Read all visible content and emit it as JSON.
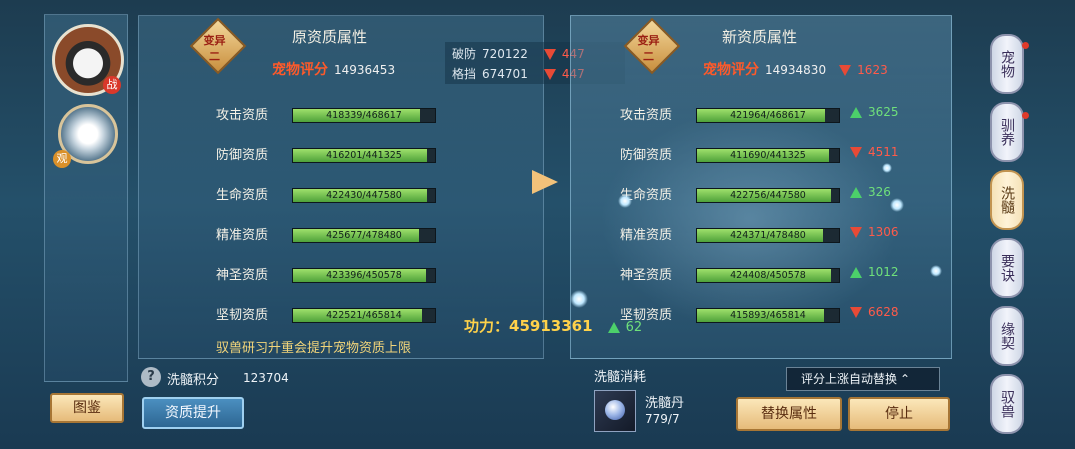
{
  "left_column": {
    "pet1_tag": "战",
    "pet2_tag": "观",
    "atlas_button": "图鉴"
  },
  "original": {
    "badge": "变异二",
    "title": "原资质属性",
    "score_label": "宠物评分",
    "score_value": "14936453",
    "attrs": [
      {
        "label": "攻击资质",
        "value": "418339/468617",
        "fill": 0.893
      },
      {
        "label": "防御资质",
        "value": "416201/441325",
        "fill": 0.943
      },
      {
        "label": "生命资质",
        "value": "422430/447580",
        "fill": 0.944
      },
      {
        "label": "精准资质",
        "value": "425677/478480",
        "fill": 0.89
      },
      {
        "label": "神圣资质",
        "value": "423396/450578",
        "fill": 0.94
      },
      {
        "label": "坚韧资质",
        "value": "422521/465814",
        "fill": 0.907
      }
    ],
    "hint": "驭兽研习升重会提升宠物资质上限"
  },
  "middle": {
    "stats": [
      {
        "label": "破防",
        "value": "720122",
        "delta": "447"
      },
      {
        "label": "格挡",
        "value": "674701",
        "delta": "447"
      }
    ],
    "power_label": "功力：",
    "power_value": "45913361",
    "power_delta": "62"
  },
  "new": {
    "badge": "变异二",
    "title": "新资质属性",
    "score_label": "宠物评分",
    "score_value": "14934830",
    "score_delta": "1623",
    "attrs": [
      {
        "label": "攻击资质",
        "value": "421964/468617",
        "fill": 0.9,
        "delta": "3625",
        "dir": "up"
      },
      {
        "label": "防御资质",
        "value": "411690/441325",
        "fill": 0.933,
        "delta": "4511",
        "dir": "down"
      },
      {
        "label": "生命资质",
        "value": "422756/447580",
        "fill": 0.945,
        "delta": "326",
        "dir": "up"
      },
      {
        "label": "精准资质",
        "value": "424371/478480",
        "fill": 0.887,
        "delta": "1306",
        "dir": "down"
      },
      {
        "label": "神圣资质",
        "value": "424408/450578",
        "fill": 0.942,
        "delta": "1012",
        "dir": "up"
      },
      {
        "label": "坚韧资质",
        "value": "415893/465814",
        "fill": 0.893,
        "delta": "6628",
        "dir": "down"
      }
    ]
  },
  "bottom": {
    "help_glyph": "?",
    "points_label": "洗髓积分",
    "points_value": "123704",
    "upgrade_button": "资质提升",
    "consume_label": "洗髓消耗",
    "item_name": "洗髓丹",
    "item_count": "779/7",
    "auto_replace": "评分上涨自动替换",
    "replace_button": "替换属性",
    "stop_button": "停止"
  },
  "tabs": [
    "宠物",
    "驯养",
    "洗髓",
    "要诀",
    "缘契",
    "驭兽"
  ],
  "active_tab": 2,
  "colors": {
    "up": "#6fe07b",
    "down": "#ff5b4a",
    "score": "#ff5a2a"
  }
}
